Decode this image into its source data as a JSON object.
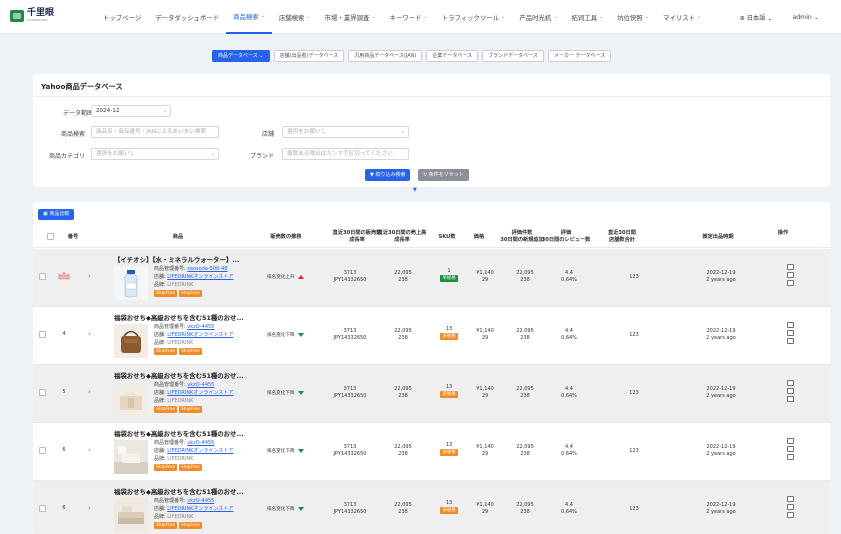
{
  "app": {
    "logo_text": "千里眼",
    "logo_sub": "CLAIRVOYANT"
  },
  "nav": {
    "items": [
      {
        "label": "トップページ",
        "dropdown": false
      },
      {
        "label": "データダッシュボード",
        "dropdown": false
      },
      {
        "label": "商品検索",
        "dropdown": true,
        "active": true
      },
      {
        "label": "店舗検索",
        "dropdown": true
      },
      {
        "label": "市場・業界調査",
        "dropdown": true
      },
      {
        "label": "キーワード",
        "dropdown": true
      },
      {
        "label": "トラフィックツール",
        "dropdown": true
      },
      {
        "label": "产品时光机",
        "dropdown": true
      },
      {
        "label": "拓词工具",
        "dropdown": true
      },
      {
        "label": "坑位快照",
        "dropdown": true
      },
      {
        "label": "マイリスト",
        "dropdown": true
      }
    ],
    "language": "日本語",
    "user": "admin"
  },
  "subtabs": [
    {
      "label": "商品データベース",
      "active": true
    },
    {
      "label": "店舗(出品者)データベース"
    },
    {
      "label": "汎用商品データベース(JAN)"
    },
    {
      "label": "企業データベース"
    },
    {
      "label": "ブランドデータベース"
    },
    {
      "label": "メーカー データベース"
    }
  ],
  "search": {
    "title": "Yahoo商品データベース",
    "date_label": "データ範囲",
    "date_value": "2024-12",
    "product_search_label": "商品検索",
    "product_search_placeholder": "商品名・商品番号・JANによるあいまい検索",
    "store_label": "店舗",
    "store_placeholder": "選択をお願いし",
    "category_label": "商品カテゴリ",
    "category_placeholder": "選択をお願いし",
    "brand_label": "ブランド",
    "brand_placeholder": "複数ある場合はカンマで区切ってください",
    "search_button": "絞り込み検索",
    "reset_button": "条件をリセット"
  },
  "table": {
    "compare_button": "商品比較",
    "headers": {
      "number": "番号",
      "product": "商品",
      "trend": "販売数の推移",
      "sales_30d_line1": "直近30日間の販売数",
      "sales_30d_line2": "成長率",
      "revenue_30d_line1": "直近30日間の売上高",
      "revenue_30d_line2": "成長率",
      "sku": "SKU数",
      "price": "価格",
      "reviews_line1": "評価件数",
      "reviews_line2": "30日間の新規追加",
      "rating_line1": "評価",
      "rating_line2": "30日間のレビュー数",
      "listings_line1": "直近30日間",
      "listings_line2": "店舗数合計",
      "date": "推定出品時期",
      "ops": "操作"
    },
    "label_manage_no": "商品管理番号:",
    "label_store": "店舗:",
    "label_brand": "品牌:",
    "rows": [
      {
        "number": "",
        "name": "【イチオシ】【水・ミネラルウォーター】...",
        "manage_no": "zaosoda-500-48",
        "store": "LIFEDRINKオンラインストア",
        "brand": "LIFEDRINK",
        "tags": [
          "ShipFree",
          "ShipFree"
        ],
        "trend_text": "排名变化上升",
        "trend_dir": "up",
        "sales": "3713",
        "sales_growth": "JPY14332650",
        "revenue": "22,095",
        "revenue_growth": "238",
        "sku": "1",
        "sku_badge": "单规格",
        "sku_type": "single",
        "price": "¥1,140",
        "price_sub": "29",
        "reviews": "22,095",
        "reviews_sub": "238",
        "rating": "4.4",
        "rating_sub": "0.64%",
        "listings": "123",
        "date": "2022-12-19",
        "date_sub": "2 years ago",
        "thumb": "bottle"
      },
      {
        "number": "4",
        "name": "福袋おせち◆高級おせちを含む51種のおせ...",
        "manage_no": "vkzO-4455",
        "store": "LIFEDRINKオンラインストア",
        "brand": "LIFEDRINK",
        "tags": [
          "ShipFree",
          "ShipFree"
        ],
        "trend_text": "排名变化下降",
        "trend_dir": "down",
        "sales": "3713",
        "sales_growth": "JPY14332650",
        "revenue": "22,095",
        "revenue_growth": "238",
        "sku": "13",
        "sku_badge": "多规格",
        "sku_type": "multi",
        "price": "¥1,140",
        "price_sub": "29",
        "reviews": "22,095",
        "reviews_sub": "238",
        "rating": "4.4",
        "rating_sub": "0.64%",
        "listings": "123",
        "date": "2022-12-19",
        "date_sub": "2 years ago",
        "thumb": "bag"
      },
      {
        "number": "5",
        "name": "福袋おせち◆高級おせちを含む51種のおせ...",
        "manage_no": "vkzO-4455",
        "store": "LIFEDRINKオンラインストア",
        "brand": "LIFEDRINK",
        "tags": [
          "ShipFree",
          "ShipFree"
        ],
        "trend_text": "排名变化下降",
        "trend_dir": "down",
        "sales": "3713",
        "sales_growth": "JPY14332650",
        "revenue": "22,095",
        "revenue_growth": "238",
        "sku": "13",
        "sku_badge": "多规格",
        "sku_type": "multi",
        "price": "¥1,140",
        "price_sub": "29",
        "reviews": "22,095",
        "reviews_sub": "238",
        "rating": "4.4",
        "rating_sub": "0.64%",
        "listings": "123",
        "date": "2022-12-19",
        "date_sub": "2 years ago",
        "thumb": "box"
      },
      {
        "number": "6",
        "name": "福袋おせち◆高級おせちを含む51種のおせ...",
        "manage_no": "vkzO-4455",
        "store": "LIFEDRINKオンラインストア",
        "brand": "LIFEDRINK",
        "tags": [
          "ShipFree",
          "ShipFree"
        ],
        "trend_text": "排名变化下降",
        "trend_dir": "down",
        "sales": "3713",
        "sales_growth": "JPY14332650",
        "revenue": "22,095",
        "revenue_growth": "238",
        "sku": "13",
        "sku_badge": "多规格",
        "sku_type": "multi",
        "price": "¥1,140",
        "price_sub": "29",
        "reviews": "22,095",
        "reviews_sub": "238",
        "rating": "4.4",
        "rating_sub": "0.64%",
        "listings": "123",
        "date": "2022-12-19",
        "date_sub": "2 years ago",
        "thumb": "room"
      },
      {
        "number": "6",
        "name": "福袋おせち◆高級おせちを含む51種のおせ...",
        "manage_no": "vkzO-4455",
        "store": "LIFEDRINKオンラインストア",
        "brand": "LIFEDRINK",
        "tags": [
          "ShipFree",
          "ShipFree"
        ],
        "trend_text": "排名变化下降",
        "trend_dir": "down",
        "sales": "3713",
        "sales_growth": "JPY14332650",
        "revenue": "22,095",
        "revenue_growth": "238",
        "sku": "13",
        "sku_badge": "多规格",
        "sku_type": "multi",
        "price": "¥1,140",
        "price_sub": "29",
        "reviews": "22,095",
        "reviews_sub": "238",
        "rating": "4.4",
        "rating_sub": "0.64%",
        "listings": "123",
        "date": "2022-12-19",
        "date_sub": "2 years ago",
        "thumb": "sofa"
      }
    ]
  },
  "colors": {
    "accent": "#2563eb",
    "tag": "#f28c28",
    "up": "#d93025",
    "down": "#1e8e3e"
  }
}
